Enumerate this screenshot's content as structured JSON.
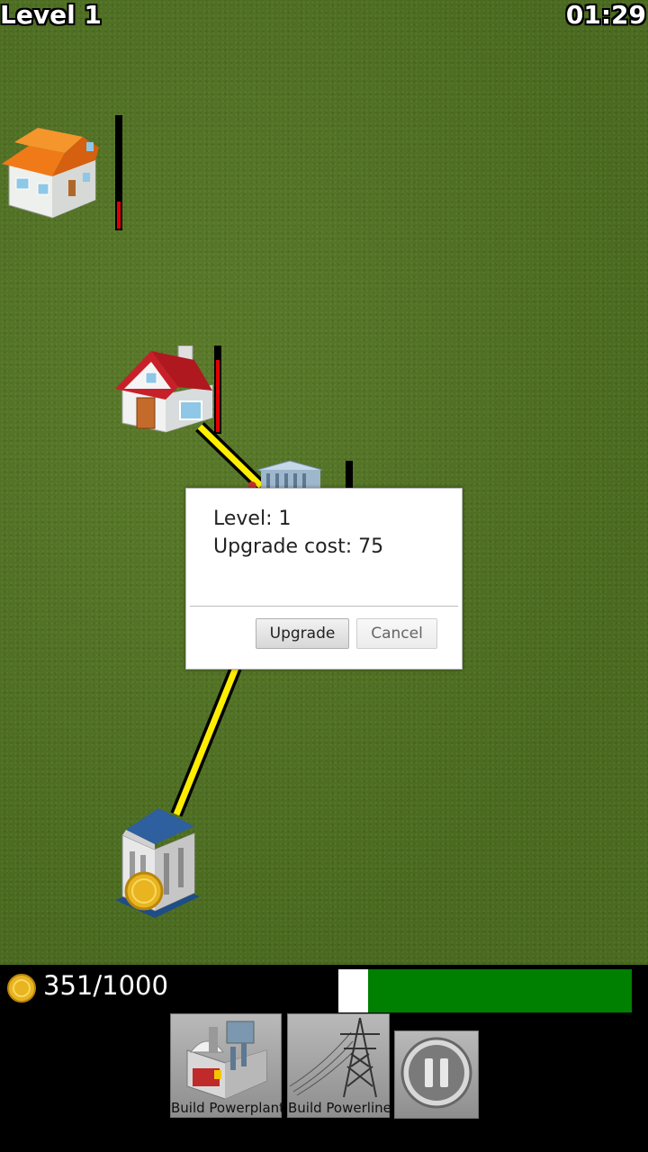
{
  "hud": {
    "level_label": "Level 1",
    "timer": "01:29"
  },
  "dialog": {
    "level_line": "Level: 1",
    "cost_line": "Upgrade cost: 75",
    "upgrade_label": "Upgrade",
    "cancel_label": "Cancel"
  },
  "status": {
    "money": "351/1000",
    "progress_fraction": 0.1
  },
  "toolbar": {
    "powerplant_label": "Build Powerplant",
    "powerline_label": "Build Powerline",
    "pause_icon": "pause-icon"
  },
  "map": {
    "houses": [
      {
        "name": "orange-roof-house",
        "demand_fraction": 0.25
      },
      {
        "name": "red-roof-house",
        "demand_fraction": 0.85
      }
    ],
    "colors": {
      "powerline": "#ffee00",
      "demand_bar": "#e00000",
      "progress": "#008000"
    }
  }
}
